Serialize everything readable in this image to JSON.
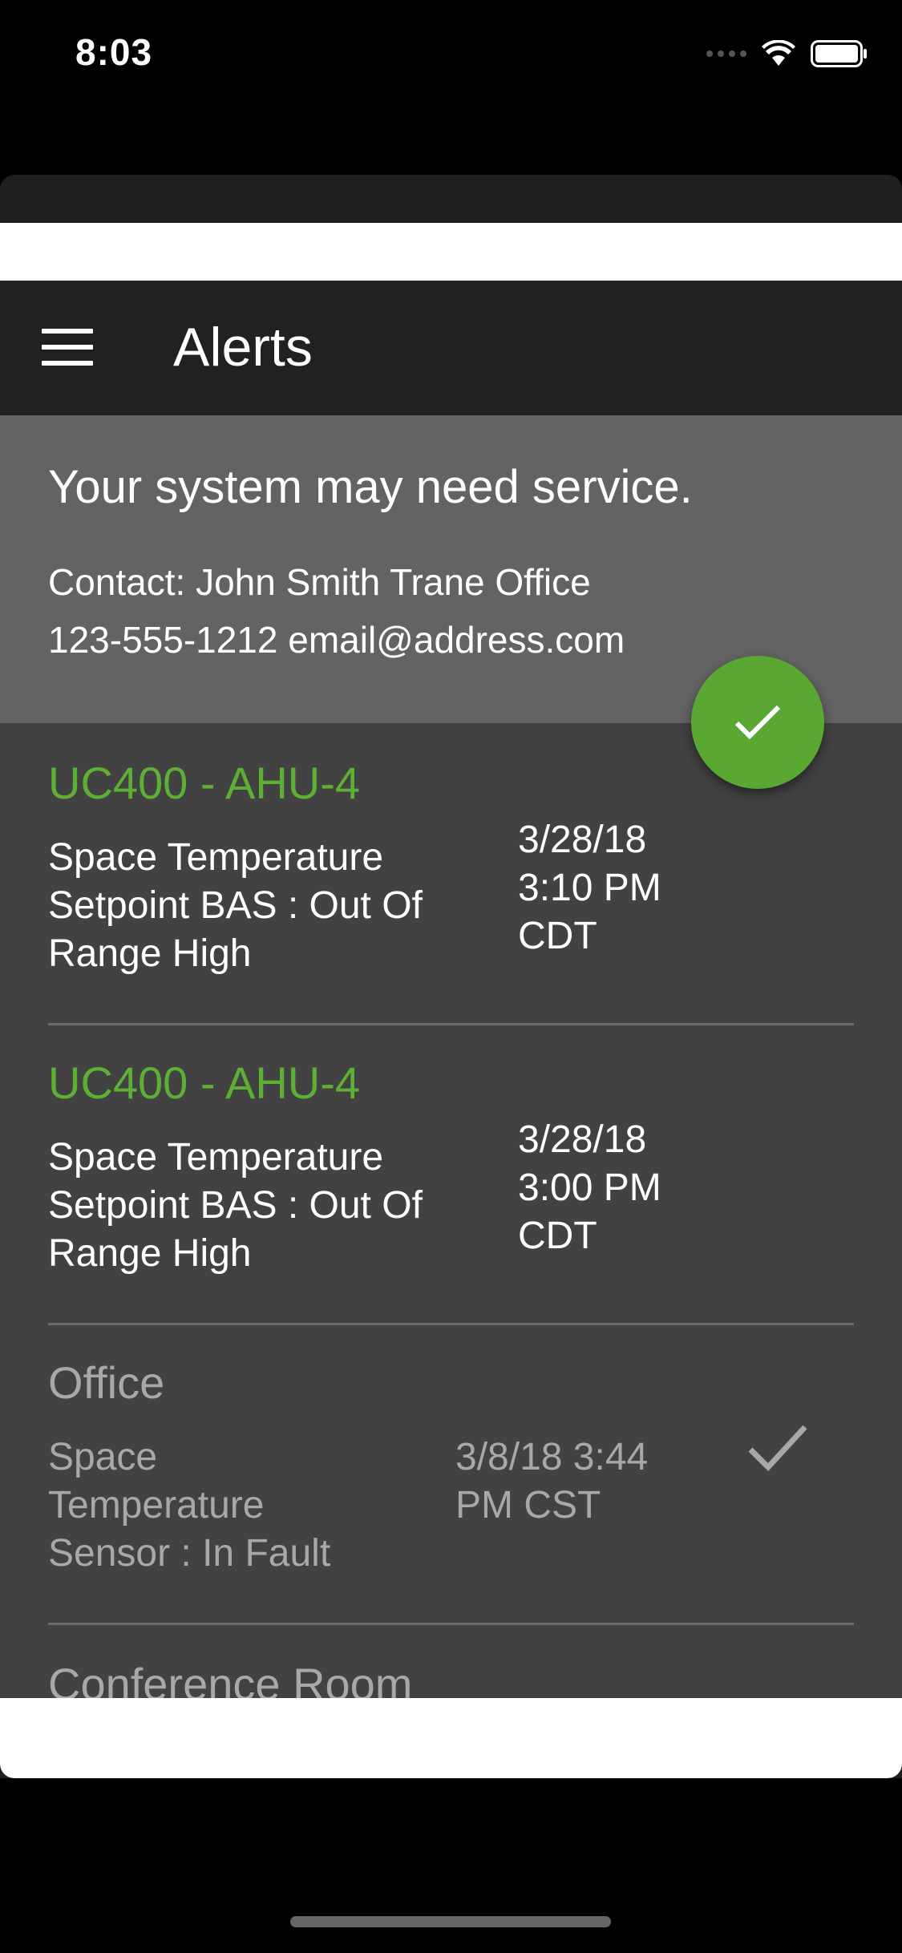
{
  "status_bar": {
    "time": "8:03"
  },
  "app_bar": {
    "title": "Alerts"
  },
  "banner": {
    "headline": "Your system may need service.",
    "contact_line1": "Contact: John Smith Trane Office",
    "contact_line2": "123-555-1212 email@address.com"
  },
  "alerts": [
    {
      "title": "UC400 - AHU-4",
      "description": "Space Temperature Setpoint BAS : Out Of Range High",
      "time": "3/28/18 3:10 PM CDT"
    },
    {
      "title": "UC400 - AHU-4",
      "description": "Space Temperature Setpoint BAS : Out Of Range High",
      "time": "3/28/18 3:00 PM CDT"
    },
    {
      "title": "Office",
      "description": "Space Temperature Sensor : In Fault",
      "time": "3/8/18 3:44 PM CST"
    },
    {
      "title": "Conference Room"
    }
  ],
  "colors": {
    "accent_green": "#5aa832",
    "app_bar": "#212121",
    "banner": "#636363",
    "list_bg": "#424242"
  }
}
